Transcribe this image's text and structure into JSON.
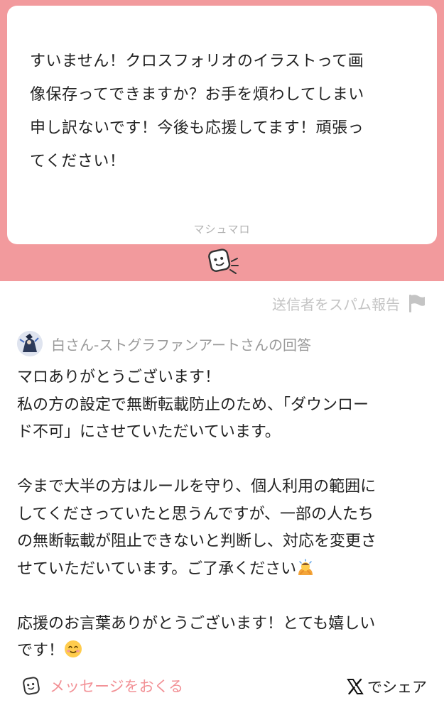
{
  "question": {
    "text": "すいません！クロスフォリオのイラストって画\n像保存ってできますか？お手を煩わしてしまい\n申し訳ないです！今後も応援してます！頑張っ\nてください！",
    "footer": "マシュマロ"
  },
  "report": {
    "label": "送信者をスパム報告"
  },
  "answer": {
    "answerer_label": "白さん-ストグラファンアートさんの回答",
    "paragraphs": {
      "p1": "マロありがとうございます！\n私の方の設定で無断転載防止のため、「ダウンロー\nド不可」にさせていただいています。",
      "p2": "今まで大半の方はルールを守り、個人利用の範囲に\nしてくださっていたと思うんですが、一部の人たち\nの無断転載が阻止できないと判断し、対応を変更さ\nせていただいています。ご了承ください",
      "p3": "応援のお言葉ありがとうございます！とても嬉しい\nです！"
    },
    "emojis": {
      "bowing": "person-bowing-emoji",
      "smiling": "smiling-face-emoji"
    }
  },
  "bottom": {
    "send_label": "メッセージをおくる",
    "share_label": "でシェア"
  },
  "colors": {
    "accent": "#f29a9d",
    "send_text": "#f29196",
    "muted": "#9a9a9a"
  }
}
